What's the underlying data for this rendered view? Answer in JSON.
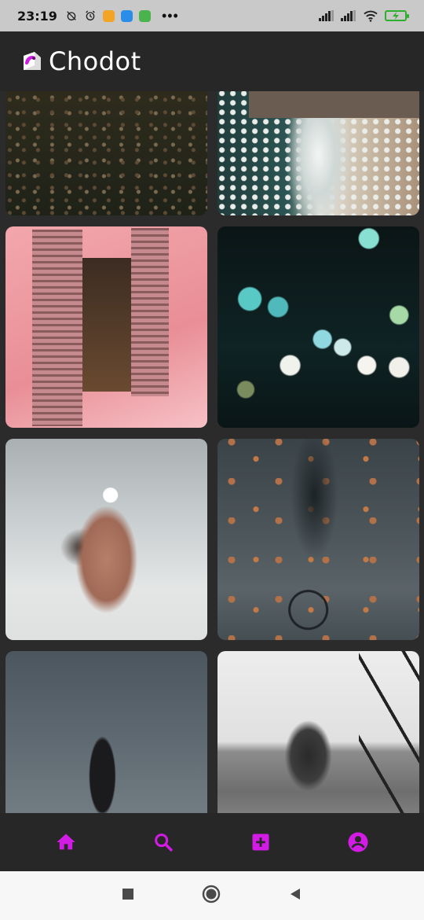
{
  "status_bar": {
    "time": "23:19",
    "overflow": "•••",
    "battery_color": "#2fae2f"
  },
  "app": {
    "title": "Chodot",
    "accent": "#d21ce6"
  },
  "feed": {
    "tiles": [
      {
        "name": "flower-field-photo"
      },
      {
        "name": "ocean-pier-photo"
      },
      {
        "name": "pink-window-person-photo"
      },
      {
        "name": "city-bokeh-lights-photo"
      },
      {
        "name": "hand-holding-flower-photo"
      },
      {
        "name": "rain-puddle-bicycle-photo"
      },
      {
        "name": "woman-reaching-sky-photo"
      },
      {
        "name": "woman-sitting-rail-photo"
      }
    ]
  },
  "bottom_nav": {
    "items": [
      {
        "icon": "home-icon",
        "active": true
      },
      {
        "icon": "search-icon",
        "active": false
      },
      {
        "icon": "add-box-icon",
        "active": false
      },
      {
        "icon": "account-circle-icon",
        "active": false
      }
    ]
  },
  "system_nav": {
    "items": [
      "recents-button",
      "home-button",
      "back-button"
    ]
  }
}
